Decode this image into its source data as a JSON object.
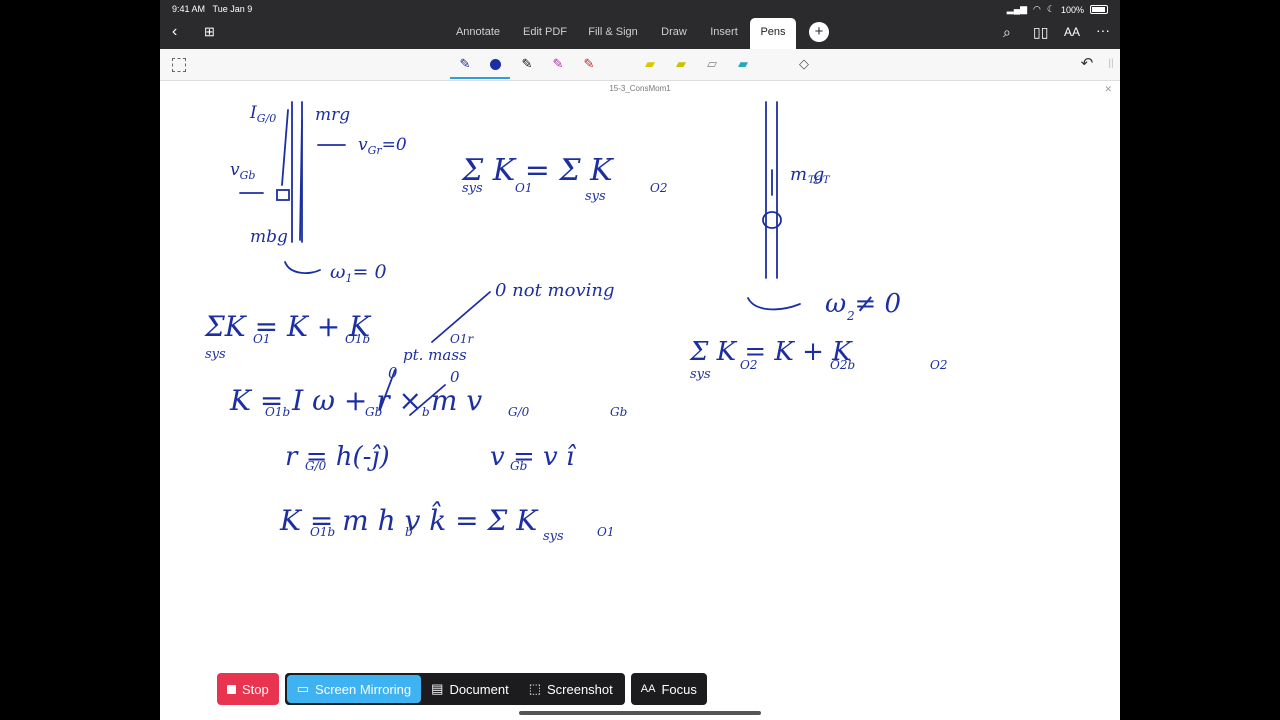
{
  "status": {
    "time": "9:41 AM",
    "date": "Tue Jan 9",
    "battery": "100%"
  },
  "tabs": [
    "Annotate",
    "Edit PDF",
    "Fill & Sign",
    "Draw",
    "Insert",
    "Pens"
  ],
  "active_tab": "Pens",
  "document": {
    "title": "15-3_ConsMom1"
  },
  "notes": {
    "left_diagram": {
      "i_g0": "I",
      "i_g0_sub": "G/0",
      "mrg": "mrg",
      "vgr": "v",
      "vgr_sub": "Gr",
      "vgr_eq": "=0",
      "vgb": "v",
      "vgb_sub": "Gb",
      "mbg": "mbg",
      "omega1": "ω",
      "omega1_sub": "1",
      "omega1_eq": "= 0"
    },
    "eq_sum_top": "Σ K  = Σ K",
    "eq_sum_top_sub1": "O1",
    "eq_sum_top_sub2": "O2",
    "eq_sum_top_sys1": "sys",
    "eq_sum_top_sys2": "sys",
    "annot_not_moving": "0 not moving",
    "eq1": "ΣK  =  K   +  K",
    "eq1_sub_a": "O1",
    "eq1_sub_b": "O1b",
    "eq1_sub_c": "O1r",
    "eq1_sys": "sys",
    "annot_pt_mass": "pt. mass",
    "eq2": "K    =  I   ω  + r    × m v",
    "eq2_sub_a": "O1b",
    "eq2_sub_b": "Gb",
    "eq2_sub_c": "b",
    "eq2_sub_d": "G/0",
    "eq2_sub_e": "Gb",
    "eq2_zero_a": "0",
    "eq2_zero_b": "0",
    "eq3_a": "r    = h(-ĵ)",
    "eq3_a_sub": "G/0",
    "eq3_b": "v   = v î",
    "eq3_b_sub": "Gb",
    "eq4": "K     = m h v k̂   =  Σ K",
    "eq4_sub_a": "O1b",
    "eq4_sub_b": "b",
    "eq4_sub_c": "O1",
    "eq4_sys": "sys",
    "right_mtot": "m   g",
    "right_mtot_sub": "TOT",
    "right_omega2": "ω  ≠ 0",
    "right_omega2_sub": "2",
    "right_eq": "Σ K   =  K    + K",
    "right_eq_sub_a": "O2",
    "right_eq_sub_b": "O2b",
    "right_eq_sub_c": "O2",
    "right_eq_sys": "sys"
  },
  "bottom_bar": {
    "stop": "Stop",
    "screen_mirroring": "Screen Mirroring",
    "document": "Document",
    "screenshot": "Screenshot",
    "focus": "Focus"
  },
  "colors": {
    "ink": "#1c2fa0",
    "accent": "#2fa0d8",
    "stop": "#e8344e",
    "mirror": "#3fb3f2"
  }
}
